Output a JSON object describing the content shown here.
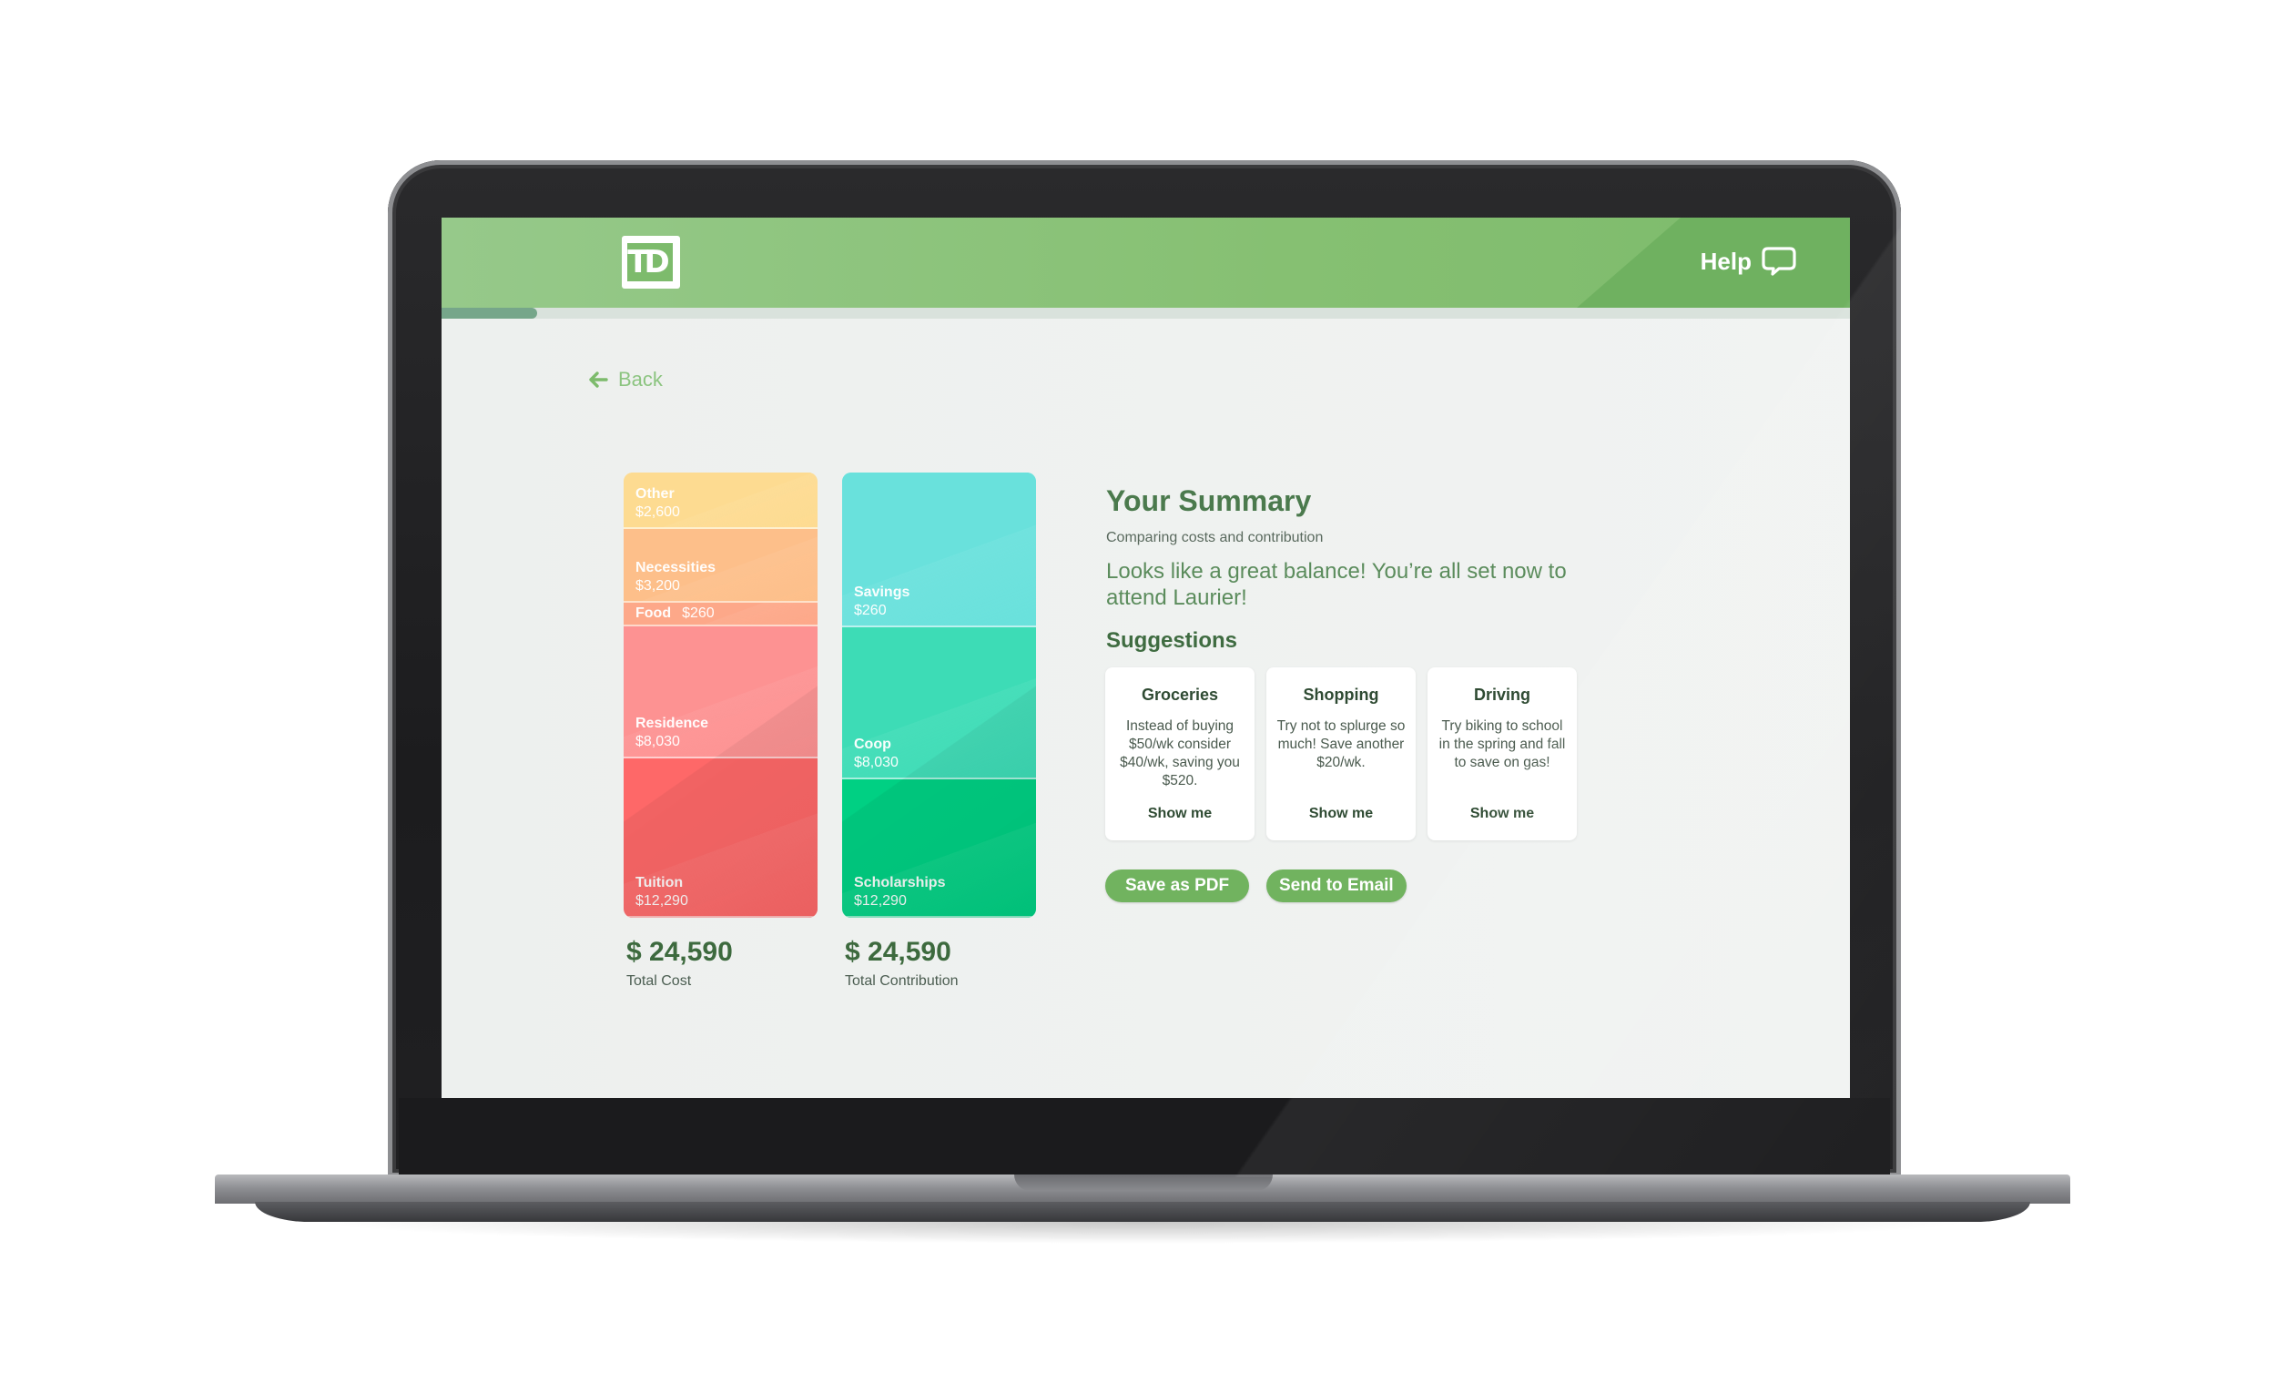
{
  "header": {
    "logo_text": "TD",
    "help_label": "Help",
    "progress": 0.068,
    "colors": {
      "header": "#86c072",
      "accent": "#71b35f"
    }
  },
  "nav": {
    "back_label": "Back",
    "back_icon": "arrow-left-icon"
  },
  "cost": {
    "segments": [
      {
        "name": "Other",
        "amount": "$2,600",
        "color": "#fddb91"
      },
      {
        "name": "Necessities",
        "amount": "$3,200",
        "color": "#fdbf8a"
      },
      {
        "name": "Food",
        "amount": "$260",
        "color": "#fda889"
      },
      {
        "name": "Residence",
        "amount": "$8,030",
        "color": "#fd9292"
      },
      {
        "name": "Tuition",
        "amount": "$12,290",
        "color": "#fe6868"
      }
    ],
    "total_amount": "$ 24,590",
    "total_label": "Total Cost"
  },
  "contribution": {
    "segments": [
      {
        "name": "Savings",
        "amount": "$260",
        "color": "#69e1dc"
      },
      {
        "name": "Coop",
        "amount": "$8,030",
        "color": "#3ddcb6"
      },
      {
        "name": "Scholarships",
        "amount": "$12,290",
        "color": "#00d083"
      }
    ],
    "total_amount": "$ 24,590",
    "total_label": "Total Contribution"
  },
  "summary": {
    "title": "Your Summary",
    "subtitle": "Comparing costs and contribution",
    "message": "Looks like a great balance! You’re all set now to attend Laurier!"
  },
  "suggestions": {
    "title": "Suggestions",
    "cards": [
      {
        "title": "Groceries",
        "text": "Instead of buying $50/wk consider $40/wk, saving you $520.",
        "link": "Show me"
      },
      {
        "title": "Shopping",
        "text": "Try not to splurge so much! Save another $20/wk.",
        "link": "Show me"
      },
      {
        "title": "Driving",
        "text": "Try biking to school in the spring and fall to save on gas!",
        "link": "Show me"
      }
    ]
  },
  "actions": {
    "save_pdf": "Save as PDF",
    "send_email": "Send to Email"
  }
}
